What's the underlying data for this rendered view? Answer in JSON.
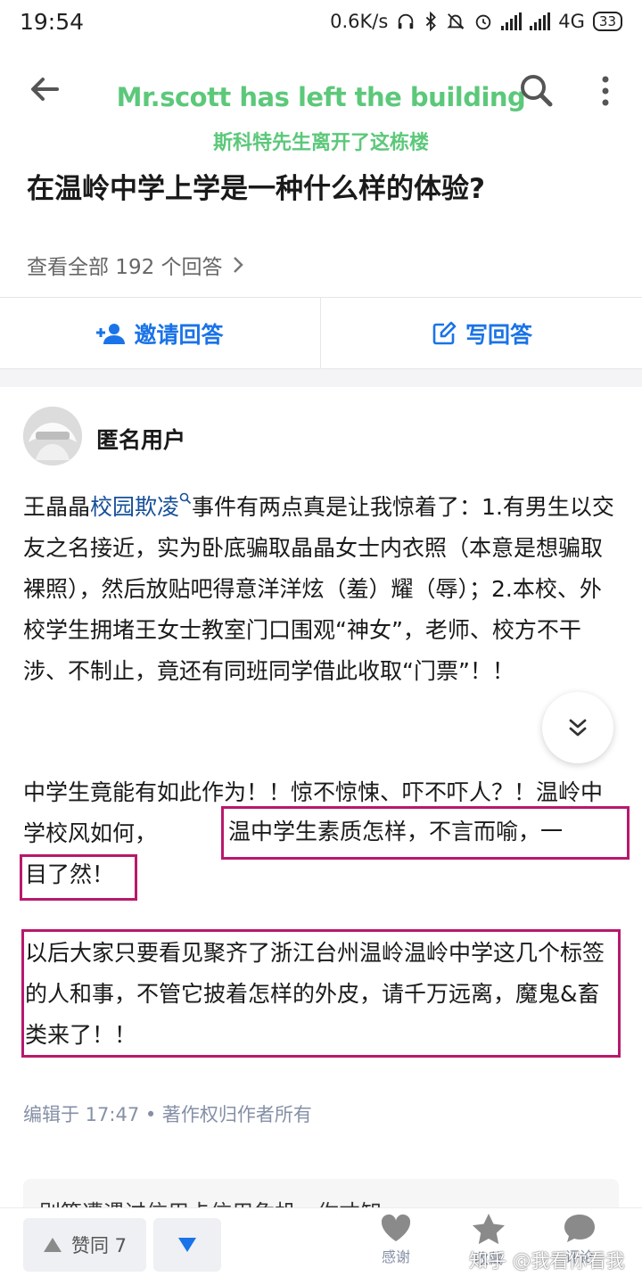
{
  "status_bar": {
    "time": "19:54",
    "net_speed": "0.6K/s",
    "network": "4G",
    "battery": "33"
  },
  "header": {
    "watermark_en": "Mr.scott has left the building",
    "watermark_zh": "斯科特先生离开了这栋楼",
    "question_title": "在温岭中学上学是一种什么样的体验?",
    "view_all": "查看全部 192 个回答"
  },
  "actions": {
    "invite": "邀请回答",
    "write": "写回答"
  },
  "answer": {
    "author": "匿名用户",
    "p1_pre": "王晶晶",
    "p1_link": "校园欺凌",
    "p1_post": "事件有两点真是让我惊着了：1.有男生以交友之名接近，实为卧底骗取晶晶女士内衣照（本意是想骗取裸照），然后放贴吧得意洋洋炫（羞）耀（辱）；2.本校、外校学生拥堵王女士教室门口围观“神女”，老师、校方不干涉、不制止，竟还有同班同学借此收取“门票”！！",
    "p2_pre": "中学生竟能有如此作为！！惊不惊悚、吓不吓人？！温岭中学校风如何，",
    "p2_box1": "温中学生素质怎样，不言而喻，一",
    "p2_box2": "目了然！",
    "p3": "以后大家只要看见聚齐了浙江台州温岭温岭中学这几个标签的人和事，不管它披着怎样的外皮，请千万远离，魔鬼&畜类来了！！",
    "edited": "编辑于 17:47 • 著作权归作者所有"
  },
  "next_card": {
    "text": "别等遭遇过信用卡信用危机，你才知"
  },
  "bottom_bar": {
    "upvote": "赞同 7",
    "thanks": "感谢",
    "collect": "收藏",
    "comment": "评论",
    "brand": "知乎 @我看你看我"
  },
  "colors": {
    "accent": "#1a73e8",
    "link": "#175199",
    "highlight_box": "#b8196c",
    "watermark": "#5cc87a"
  }
}
